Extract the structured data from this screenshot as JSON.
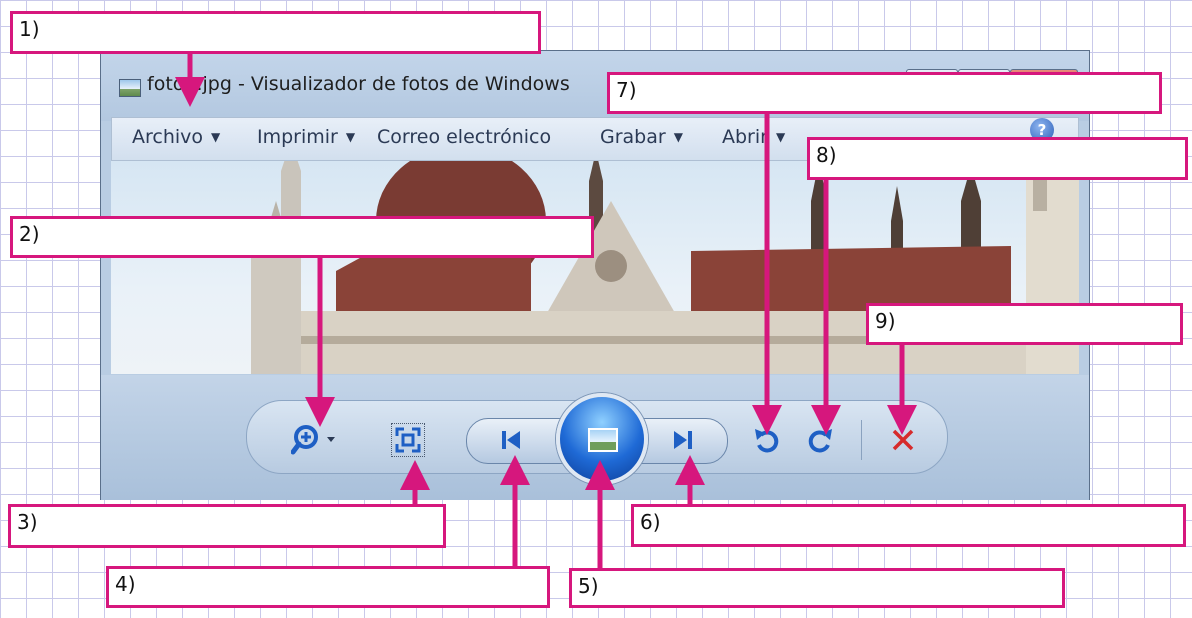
{
  "window": {
    "title": "foto1.jpg - Visualizador de fotos de Windows"
  },
  "menubar": {
    "items": [
      {
        "label": "Archivo",
        "has_dropdown": true
      },
      {
        "label": "Imprimir",
        "has_dropdown": true
      },
      {
        "label": "Correo electrónico",
        "has_dropdown": false
      },
      {
        "label": "Grabar",
        "has_dropdown": true
      },
      {
        "label": "Abrir",
        "has_dropdown": true
      }
    ],
    "help_icon": "help-icon",
    "help_label": "?"
  },
  "controls": [
    {
      "name": "zoom",
      "icon": "zoom-icon"
    },
    {
      "name": "fit-to-window",
      "icon": "fit-window-icon"
    },
    {
      "name": "previous",
      "icon": "previous-icon"
    },
    {
      "name": "slideshow",
      "icon": "slideshow-icon"
    },
    {
      "name": "next",
      "icon": "next-icon"
    },
    {
      "name": "rotate-left",
      "icon": "rotate-counterclockwise-icon"
    },
    {
      "name": "rotate-right",
      "icon": "rotate-clockwise-icon"
    },
    {
      "name": "delete",
      "icon": "delete-icon"
    }
  ],
  "callouts": [
    {
      "label": "1)"
    },
    {
      "label": "2)"
    },
    {
      "label": "3)"
    },
    {
      "label": "4)"
    },
    {
      "label": "5)"
    },
    {
      "label": "6)"
    },
    {
      "label": "7)"
    },
    {
      "label": "8)"
    },
    {
      "label": "9)"
    }
  ],
  "colors": {
    "annotation": "#d6177d",
    "delete": "#d62b2b",
    "control_blue": "#1e5fc4"
  }
}
